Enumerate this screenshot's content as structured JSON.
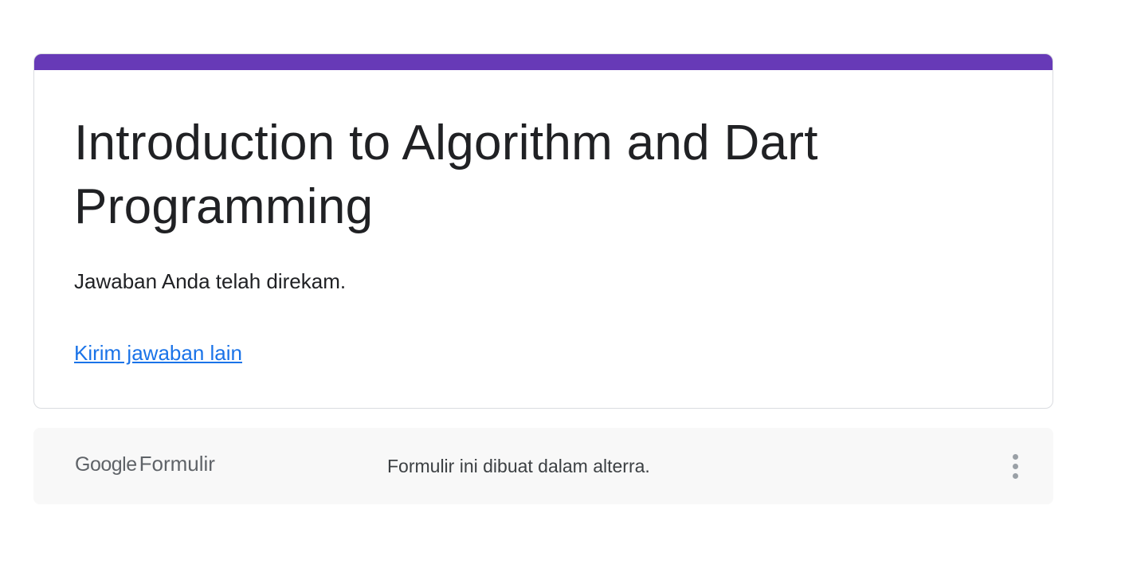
{
  "form": {
    "title": "Introduction to Algorithm and Dart Programming",
    "confirmation_message": "Jawaban Anda telah direkam.",
    "submit_another_link": "Kirim jawaban lain"
  },
  "footer": {
    "brand_google": "Google",
    "brand_product": "Formulir",
    "note": "Formulir ini dibuat dalam alterra.",
    "menu_icon": "more-vert-icon"
  },
  "colors": {
    "accent": "#673ab7",
    "link": "#1a73e8",
    "text": "#202124",
    "footer_bg": "#f8f8f8"
  }
}
